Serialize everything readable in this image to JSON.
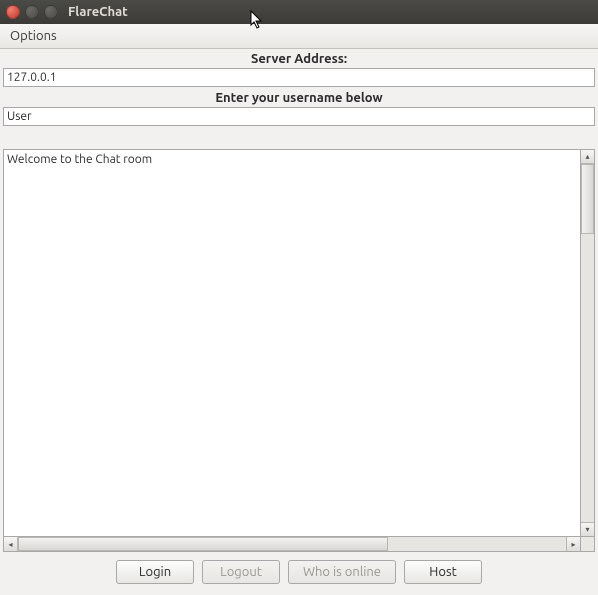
{
  "window": {
    "title": "FlareChat"
  },
  "menu": {
    "options": "Options"
  },
  "labels": {
    "server_address": "Server Address:",
    "username_prompt": "Enter your username below"
  },
  "inputs": {
    "server_address_value": "127.0.0.1",
    "username_value": "User"
  },
  "chat": {
    "welcome_message": "Welcome to the Chat room"
  },
  "buttons": {
    "login": "Login",
    "logout": "Logout",
    "who_is_online": "Who is online",
    "host": "Host"
  }
}
